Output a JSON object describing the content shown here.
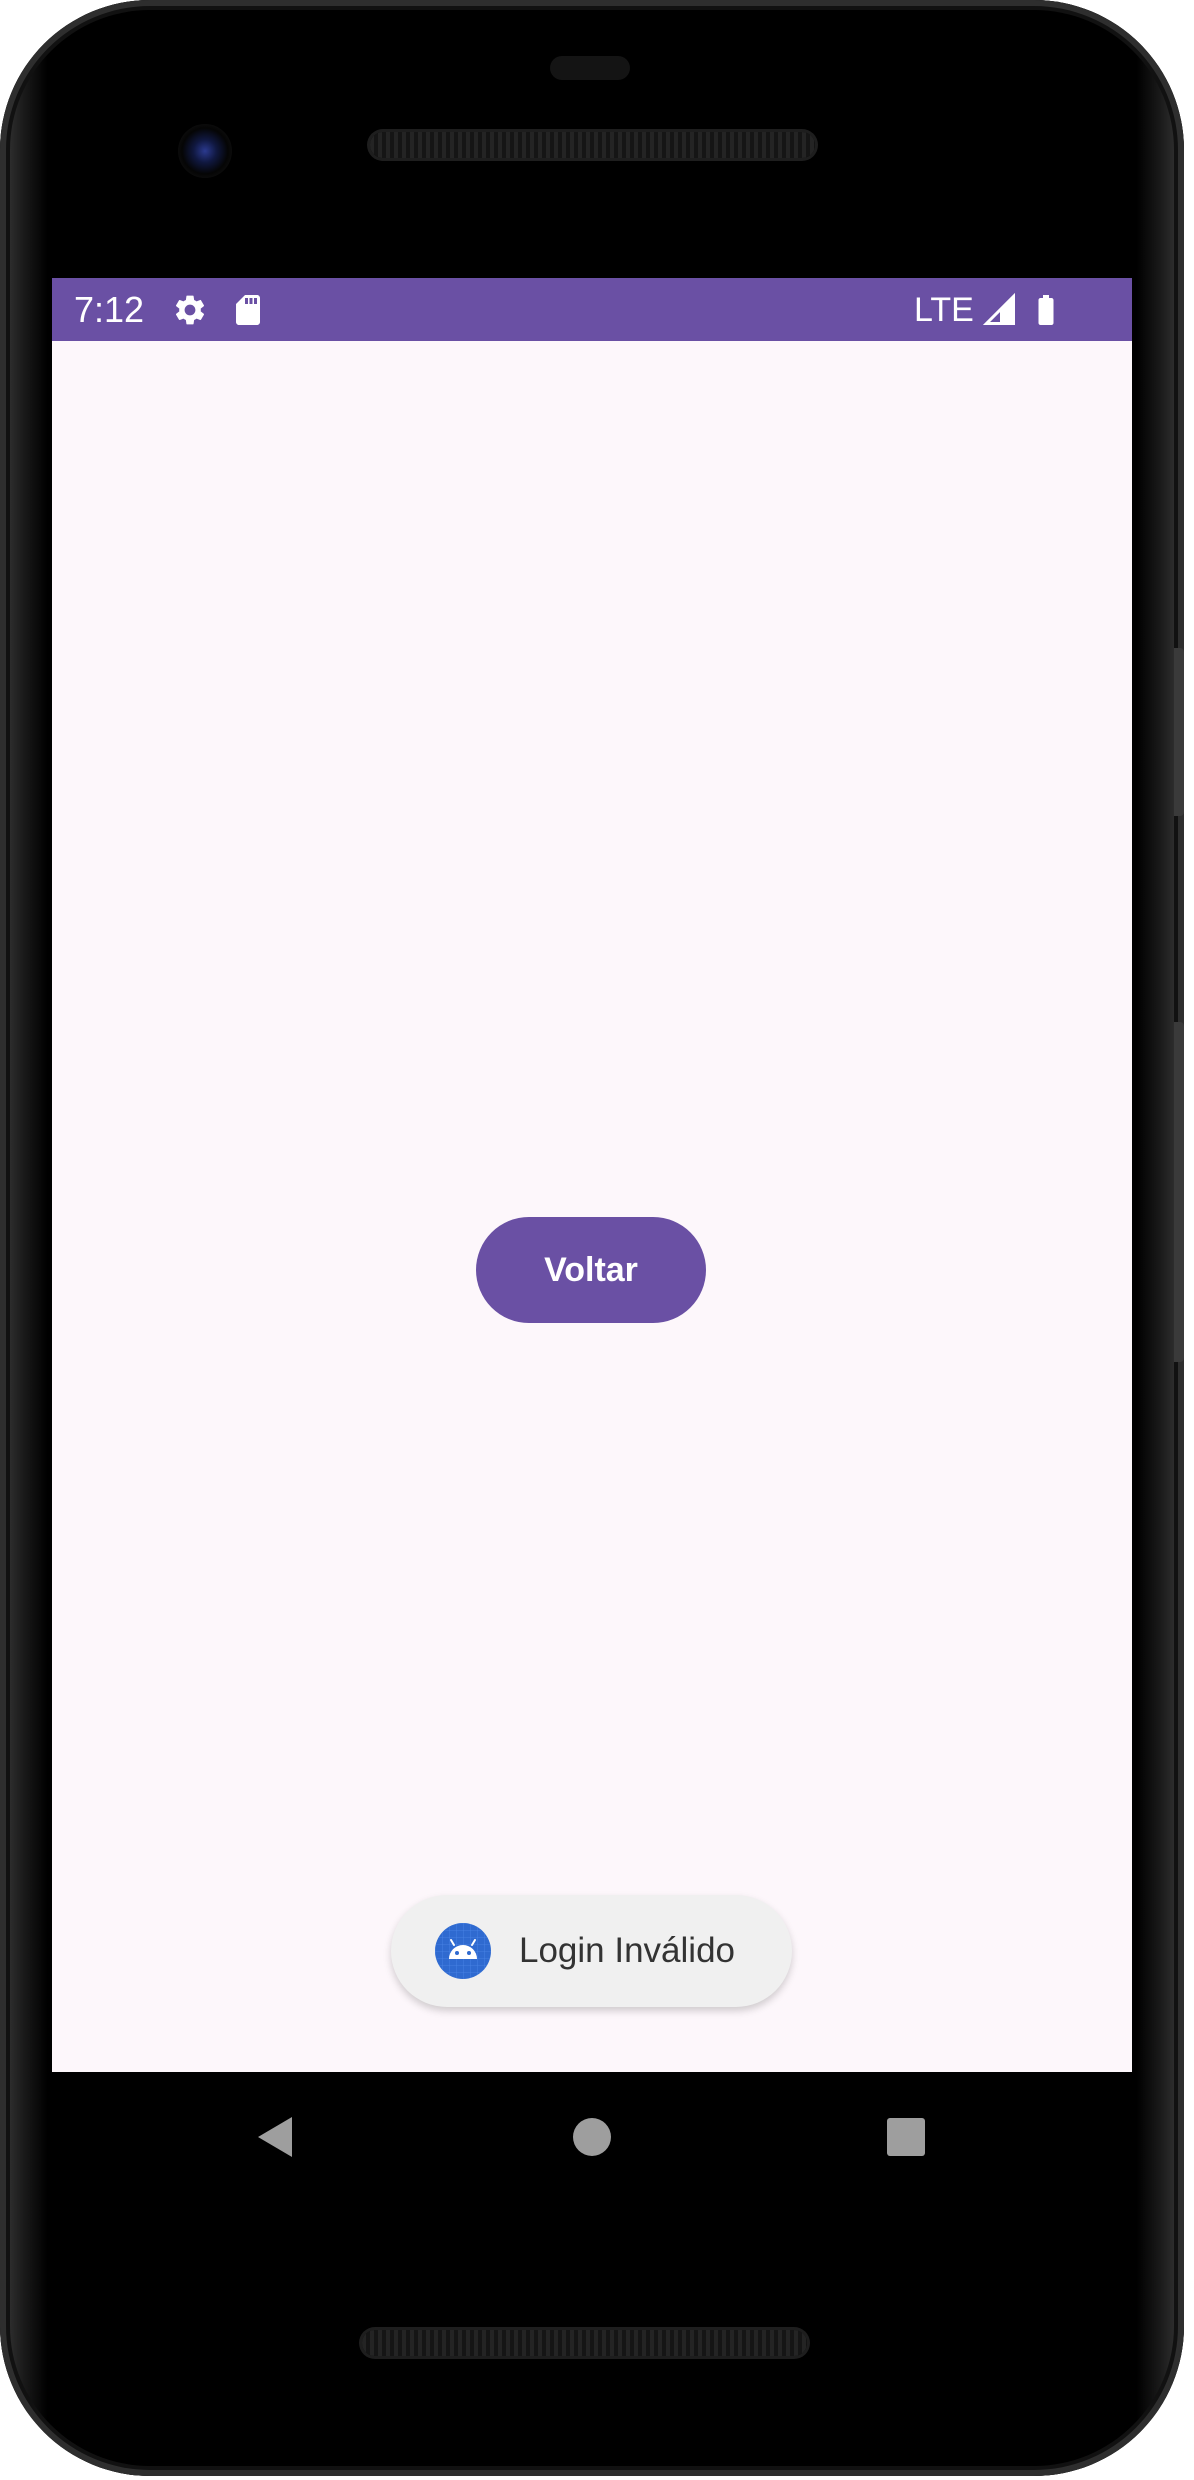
{
  "status_bar": {
    "time": "7:12",
    "network": "LTE",
    "icons": [
      "gear-icon",
      "sd-card-icon",
      "signal-icon",
      "battery-icon"
    ],
    "background_color": "#6a50a4"
  },
  "main": {
    "back_button_label": "Voltar",
    "background_color": "#fdf7fb"
  },
  "toast": {
    "message": "Login Inválido",
    "icon": "android-app-icon"
  },
  "navigation_bar": {
    "buttons": [
      "back-nav-icon",
      "home-nav-icon",
      "recents-nav-icon"
    ]
  },
  "colors": {
    "accent": "#6a50a4",
    "toast_background": "#f0f0f0",
    "toast_text": "#333333"
  }
}
